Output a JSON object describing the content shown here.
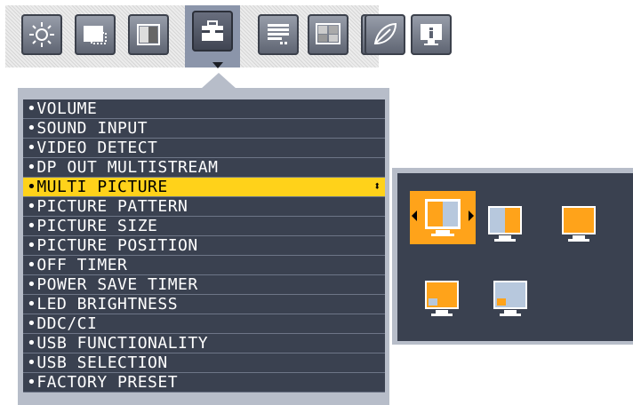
{
  "toolbar": {
    "tabs": [
      {
        "icon": "brightness-icon"
      },
      {
        "icon": "screen-icon"
      },
      {
        "icon": "color-icon"
      },
      {
        "icon": "toolbox-icon",
        "active": true
      },
      {
        "icon": "menu-tools-icon"
      },
      {
        "icon": "eco-icon"
      },
      {
        "icon": "leaf-icon"
      },
      {
        "icon": "info-icon"
      }
    ]
  },
  "menu": {
    "items": [
      {
        "label": "•VOLUME"
      },
      {
        "label": "•SOUND  INPUT"
      },
      {
        "label": "•VIDEO  DETECT"
      },
      {
        "label": "•DP  OUT  MULTISTREAM"
      },
      {
        "label": "•MULTI  PICTURE",
        "selected": true
      },
      {
        "label": "•PICTURE  PATTERN"
      },
      {
        "label": "•PICTURE  SIZE"
      },
      {
        "label": "•PICTURE  POSITION"
      },
      {
        "label": "•OFF  TIMER"
      },
      {
        "label": "•POWER  SAVE  TIMER"
      },
      {
        "label": "•LED  BRIGHTNESS"
      },
      {
        "label": "•DDC/CI"
      },
      {
        "label": "•USB  FUNCTIONALITY"
      },
      {
        "label": "•USB  SELECTION"
      },
      {
        "label": "•FACTORY  PRESET"
      }
    ]
  },
  "colors": {
    "panel_border": "#b7bdc9",
    "panel_bg": "#3a4150",
    "highlight": "#ffd21a",
    "option_accent": "#ffa31a"
  },
  "submenu": {
    "options": [
      {
        "name": "side-by-side-split",
        "selected": true
      },
      {
        "name": "side-by-side-orange-right"
      },
      {
        "name": "full-orange"
      },
      {
        "name": "picture-in-picture-orange"
      },
      {
        "name": "picture-in-picture-blue"
      }
    ]
  }
}
